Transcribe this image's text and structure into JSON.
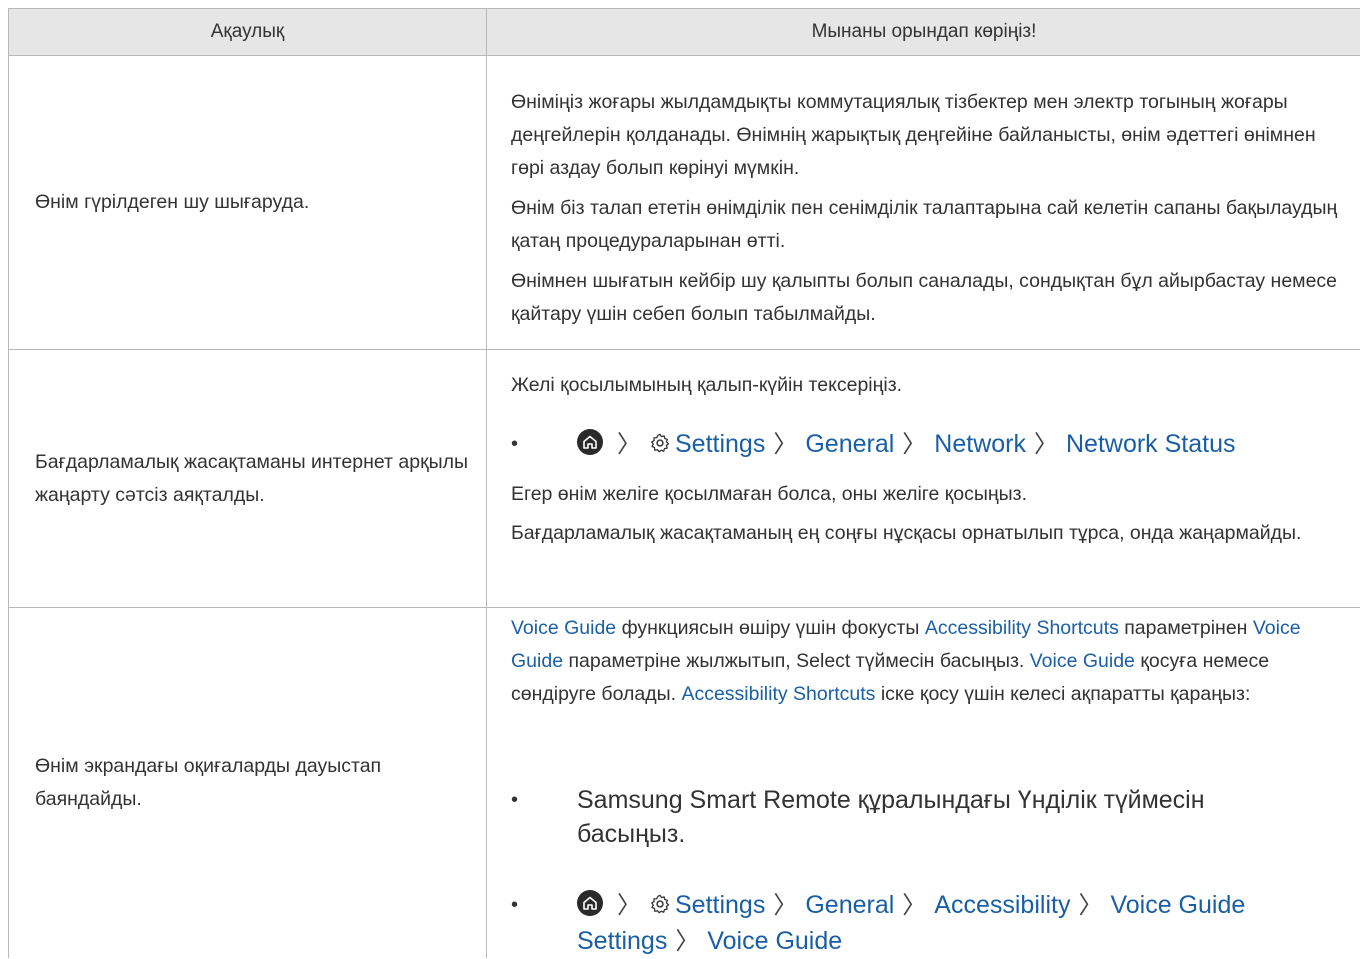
{
  "header": {
    "col1": "Ақаулық",
    "col2": "Мынаны орындап көріңіз!"
  },
  "rows": [
    {
      "problem": "Өнім гүрілдеген шу шығаруда.",
      "p1": "Өніміңіз жоғары жылдамдықты коммутациялық тізбектер мен электр тогының жоғары деңгейлерін қолданады. Өнімнің жарықтық деңгейіне байланысты, өнім әдеттегі өнімнен гөрі аздау болып көрінуі мүмкін.",
      "p2": "Өнім біз талап ететін өнімділік пен сенімділік талаптарына сай келетін сапаны бақылаудың қатаң процедураларынан өтті.",
      "p3": "Өнімнен шығатын кейбір шу қалыпты болып саналады, сондықтан бұл айырбастау немесе қайтару үшін себеп болып табылмайды."
    },
    {
      "problem": "Бағдарламалық жасақтаманы интернет арқылы жаңарту сәтсіз аяқталды.",
      "p1": "Желі қосылымының қалып-күйін тексеріңіз.",
      "path": [
        "Settings",
        "General",
        "Network",
        "Network Status"
      ],
      "p2": "Егер өнім желіге қосылмаған болса, оны желіге қосыңыз.",
      "p3": "Бағдарламалық жасақтаманың ең соңғы нұсқасы орнатылып тұрса, онда жаңармайды."
    },
    {
      "problem": "Өнім экрандағы оқиғаларды дауыстап баяндайды.",
      "link_voice_guide": "Voice Guide",
      "link_accessibility_shortcuts": "Accessibility Shortcuts",
      "t1": " функциясын өшіру үшін фокусты ",
      "t2": " параметрінен ",
      "t3": " параметріне жылжытып, Select түймесін басыңыз. ",
      "t4": " қосуға немесе сөндіруге болады. ",
      "t5": " іске қосу үшін келесі ақпаратты қараңыз:",
      "bullet1": "Samsung Smart Remote құралындағы Үнділік түймесін басыңыз.",
      "path": [
        "Settings",
        "General",
        "Accessibility",
        "Voice Guide Settings",
        "Voice Guide"
      ]
    }
  ],
  "bullet_char": "•",
  "separator": "〉",
  "icons": {
    "home": "home-icon",
    "settings": "gear-icon"
  },
  "colors": {
    "link": "#1a5fa6",
    "header_bg": "#e6e6e6",
    "border": "#b9b9b9"
  }
}
